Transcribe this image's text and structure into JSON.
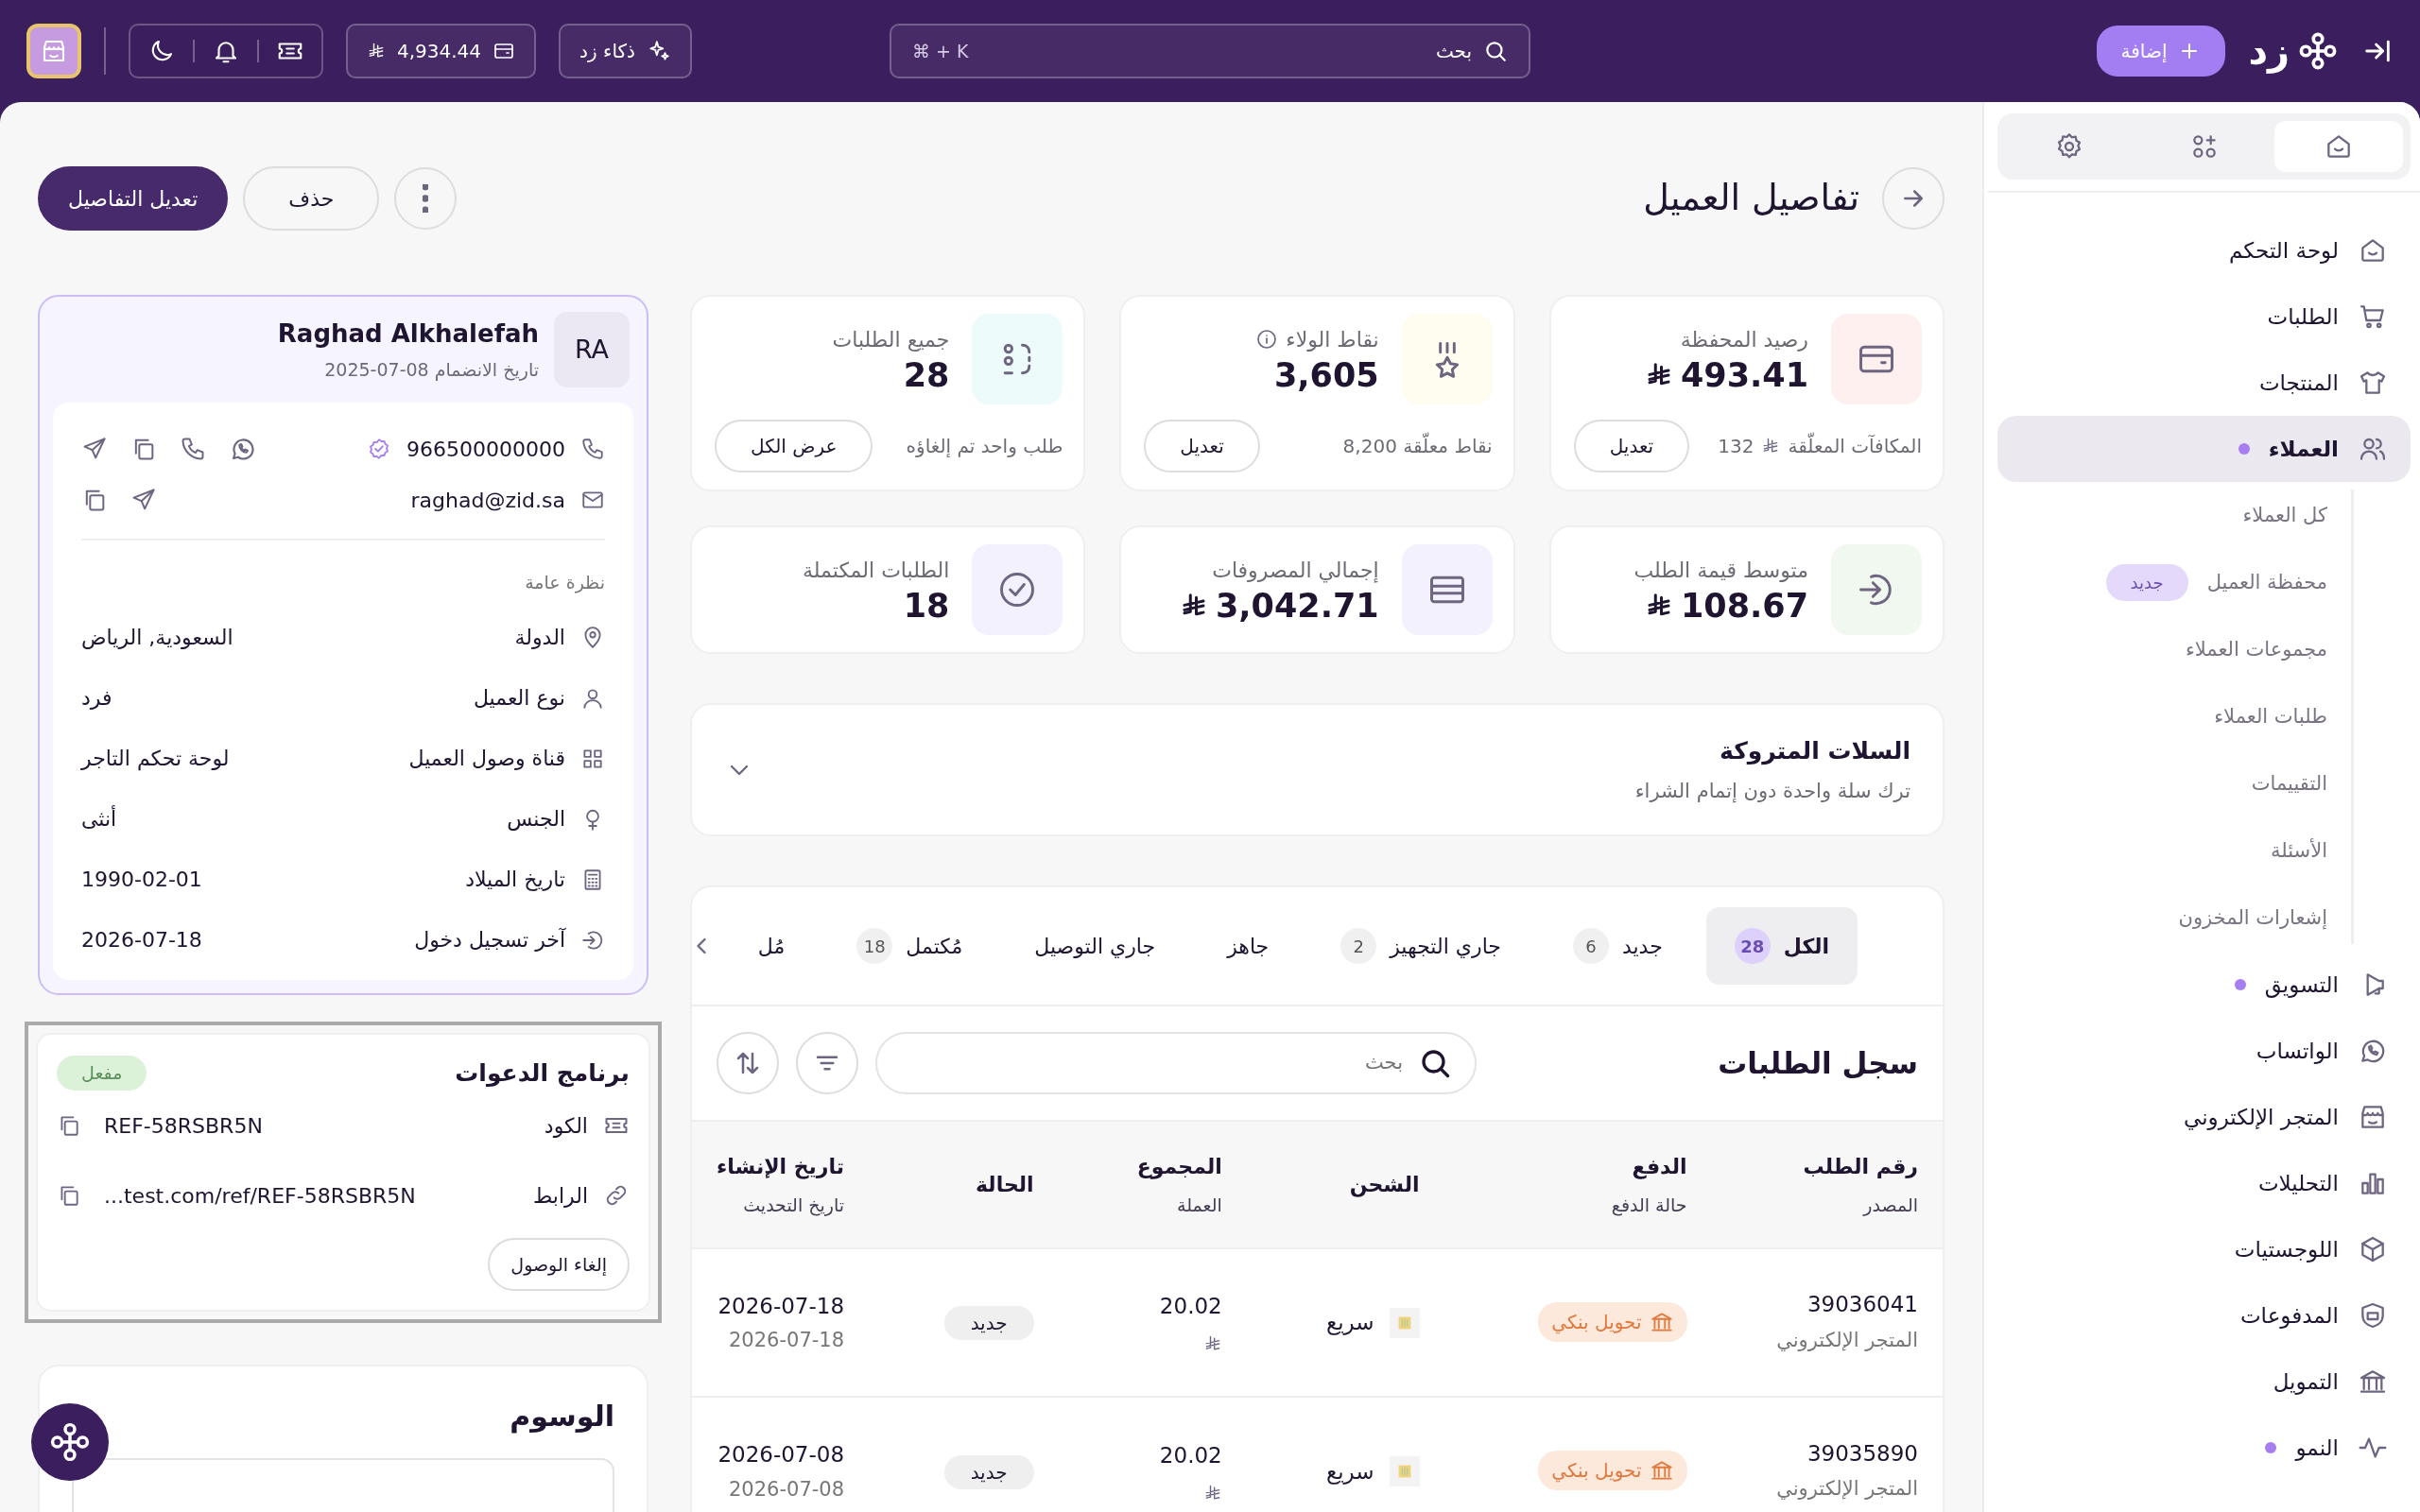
{
  "topbar": {
    "add_button": "إضافة",
    "logo_text": "زد",
    "search_placeholder": "بحث",
    "shortcut": "⌘ + K",
    "ai_button": "ذكاء زد",
    "balance": "4,934.44"
  },
  "sidebar": {
    "tabs": [
      {
        "selected": true
      },
      {
        "selected": false
      },
      {
        "selected": false
      }
    ],
    "items": [
      {
        "label": "لوحة التحكم",
        "selected": false,
        "dot": false
      },
      {
        "label": "الطلبات",
        "selected": false,
        "dot": false
      },
      {
        "label": "المنتجات",
        "selected": false,
        "dot": false
      },
      {
        "label": "العملاء",
        "selected": true,
        "dot": true,
        "children": [
          {
            "label": "كل العملاء"
          },
          {
            "label": "محفظة العميل",
            "badge": "جديد"
          },
          {
            "label": "مجموعات العملاء"
          },
          {
            "label": "طلبات العملاء"
          },
          {
            "label": "التقييمات"
          },
          {
            "label": "الأسئلة"
          },
          {
            "label": "إشعارات المخزون"
          }
        ]
      },
      {
        "label": "التسويق",
        "selected": false,
        "dot": true
      },
      {
        "label": "الواتساب",
        "selected": false,
        "dot": false
      },
      {
        "label": "المتجر الإلكتروني",
        "selected": false,
        "dot": false
      },
      {
        "label": "التحليلات",
        "selected": false,
        "dot": false
      },
      {
        "label": "اللوجستيات",
        "selected": false,
        "dot": false
      },
      {
        "label": "المدفوعات",
        "selected": false,
        "dot": false
      },
      {
        "label": "التمويل",
        "selected": false,
        "dot": false
      },
      {
        "label": "النمو",
        "selected": false,
        "dot": true
      }
    ]
  },
  "page": {
    "title": "تفاصيل العميل",
    "edit_button": "تعديل التفاصيل",
    "delete_button": "حذف"
  },
  "stats": [
    {
      "label": "رصيد المحفظة",
      "value": "493.41",
      "currency": true,
      "color": "#fdf0ee",
      "footer": "المكافآت المعلّقة",
      "footer_amount": "132",
      "action": "تعديل"
    },
    {
      "label": "نقاط الولاء",
      "info": true,
      "value": "3,605",
      "color": "#fefdf0",
      "footer": "8,200 نقاط معلّقة",
      "action": "تعديل"
    },
    {
      "label": "جميع الطلبات",
      "value": "28",
      "color": "#eefbfb",
      "footer": "طلب واحد تم إلغاؤه",
      "action": "عرض الكل"
    },
    {
      "label": "متوسط قيمة الطلب",
      "value": "108.67",
      "currency": true,
      "color": "#f1f8ef"
    },
    {
      "label": "إجمالي المصروفات",
      "value": "3,042.71",
      "currency": true,
      "color": "#f3f1fe"
    },
    {
      "label": "الطلبات المكتملة",
      "value": "18",
      "color": "#f3f1fe"
    }
  ],
  "abandoned": {
    "title": "السلات المتروكة",
    "subtitle": "ترك سلة واحدة دون إتمام الشراء",
    "expanded": false
  },
  "orders": {
    "tabs": [
      {
        "label": "الكل",
        "count": "28",
        "selected": true
      },
      {
        "label": "جديد",
        "count": "6",
        "selected": false
      },
      {
        "label": "جاري التجهيز",
        "count": "2",
        "selected": false
      },
      {
        "label": "جاهز",
        "selected": false
      },
      {
        "label": "جاري التوصيل",
        "selected": false
      },
      {
        "label": "مُكتمل",
        "count": "18",
        "selected": false
      },
      {
        "label": "مُل",
        "selected": false
      }
    ],
    "title": "سجل الطلبات",
    "search_placeholder": "بحث",
    "columns": [
      {
        "title": "رقم الطلب",
        "subtitle": "المصدر"
      },
      {
        "title": "الدفع",
        "subtitle": "حالة الدفع"
      },
      {
        "title": "الشحن"
      },
      {
        "title": "المجموع",
        "subtitle": "العملة"
      },
      {
        "title": "الحالة"
      },
      {
        "title": "تاريخ الإنشاء",
        "subtitle": "تاريخ التحديث"
      }
    ],
    "rows": [
      {
        "order_no": "39036041",
        "source": "المتجر الإلكتروني",
        "payment": "تحويل بنكي",
        "shipping": "سريع",
        "total": "20.02",
        "status": "جديد",
        "created": "2026-07-18",
        "updated": "2026-07-18"
      },
      {
        "order_no": "39035890",
        "source": "المتجر الإلكتروني",
        "payment": "تحويل بنكي",
        "shipping": "سريع",
        "total": "20.02",
        "status": "جديد",
        "created": "2026-07-08",
        "updated": "2026-07-08"
      }
    ]
  },
  "customer": {
    "initials": "RA",
    "name": "Raghad Alkhalefah",
    "joined": "تاريخ الانضمام 08-07-2025",
    "phone": "966500000000",
    "phone_verified": true,
    "email": "raghad@zid.sa",
    "overview_title": "نظرة عامة",
    "fields": [
      {
        "label": "الدولة",
        "value": "السعودية, الرياض"
      },
      {
        "label": "نوع العميل",
        "value": "فرد"
      },
      {
        "label": "قناة وصول العميل",
        "value": "لوحة تحكم التاجر"
      },
      {
        "label": "الجنس",
        "value": "أنثى"
      },
      {
        "label": "تاريخ الميلاد",
        "value": "1990-02-01"
      },
      {
        "label": "آخر تسجيل دخول",
        "value": "2026-07-18"
      }
    ]
  },
  "referral": {
    "title": "برنامج الدعوات",
    "status": "مفعل",
    "active": true,
    "focused": true,
    "code_label": "الكود",
    "code": "REF-58RSBR5N",
    "link_label": "الرابط",
    "link": "...test.com/ref/REF-58RSBR5N",
    "revoke_button": "إلغاء الوصول"
  },
  "tags": {
    "title": "الوسوم"
  }
}
